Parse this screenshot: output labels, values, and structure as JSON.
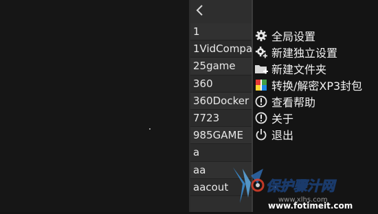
{
  "file_list": {
    "items": [
      "1",
      "1VidCompa",
      "25game",
      "360",
      "360Docker",
      "7723",
      "985GAME",
      "a",
      "aa",
      "aacout"
    ]
  },
  "menu": {
    "items": [
      {
        "label": "全局设置",
        "icon": "gear-icon"
      },
      {
        "label": "新建独立设置",
        "icon": "gear-add-icon"
      },
      {
        "label": "新建文件夹",
        "icon": "folder-add-icon"
      },
      {
        "label": "转换/解密XP3封包",
        "icon": "convert-icon"
      },
      {
        "label": "查看帮助",
        "icon": "help-icon"
      },
      {
        "label": "关于",
        "icon": "info-icon"
      },
      {
        "label": "退出",
        "icon": "power-icon"
      }
    ]
  },
  "watermark": {
    "brand": "保护骤汁网",
    "url1": "www.xlhs.com",
    "url2": "www.fotimeit.com"
  },
  "colors": {
    "background": "#141414",
    "list_bg": "#2e2e2e",
    "text": "#f0f0f0",
    "watermark_blue": "#3a8fd8",
    "watermark_red": "#e0402a"
  }
}
